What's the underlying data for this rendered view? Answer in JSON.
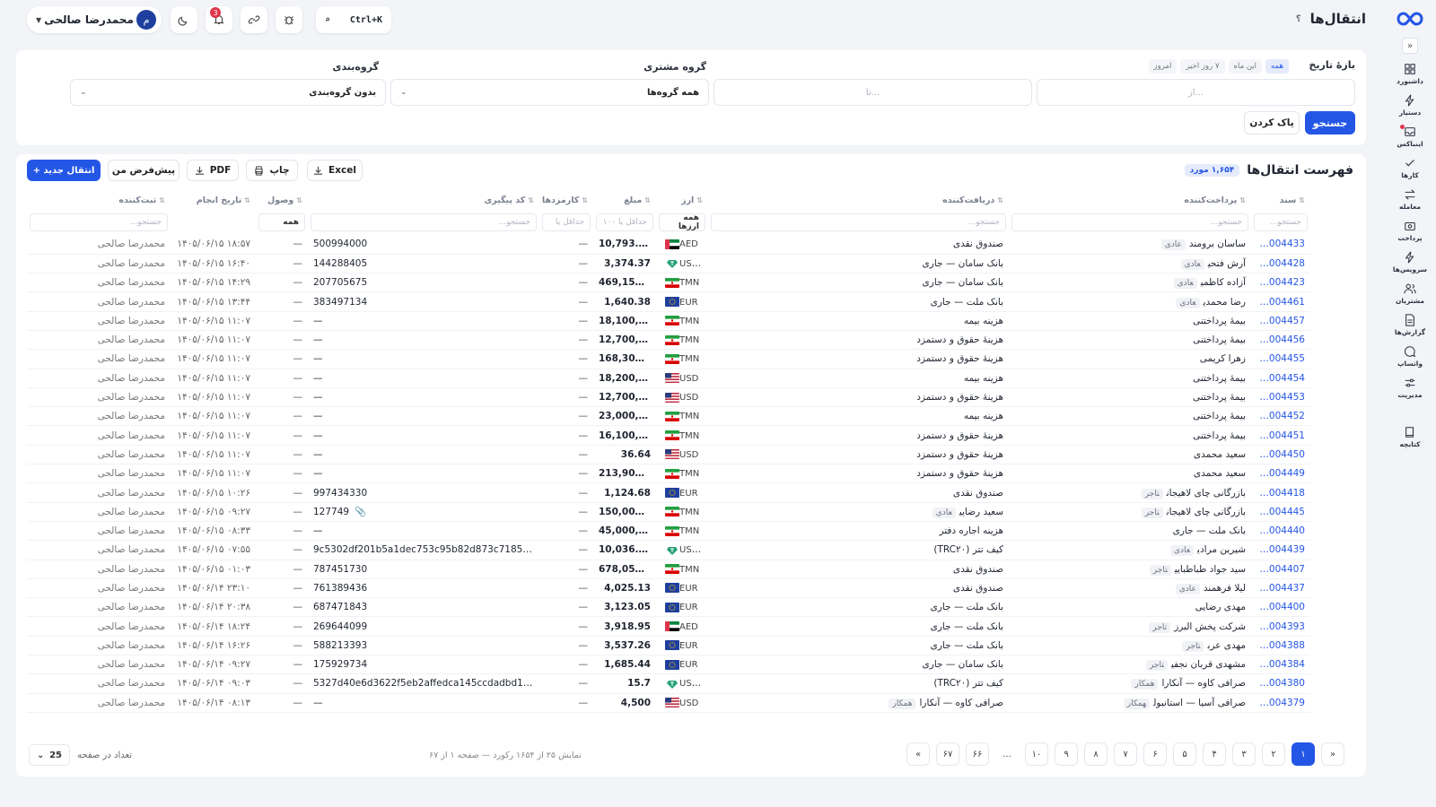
{
  "header": {
    "title": "انتقال‌ها",
    "help": "؟",
    "search_shortcut": "Ctrl+K",
    "notifications_count": "3",
    "user_name": "محمدرضا صالحی",
    "user_initial": "م"
  },
  "sidebar": {
    "items": [
      {
        "label": "داشبورد",
        "icon": "dashboard-icon"
      },
      {
        "label": "دستیار",
        "icon": "bolt-icon"
      },
      {
        "label": "اینباکس",
        "icon": "inbox-icon"
      },
      {
        "label": "کارها",
        "icon": "check-icon"
      },
      {
        "label": "معامله",
        "icon": "swap-icon"
      },
      {
        "label": "پرداخت",
        "icon": "payment-icon"
      },
      {
        "label": "سرویس‌ها",
        "icon": "bolt-icon"
      },
      {
        "label": "مشتریان",
        "icon": "users-icon"
      },
      {
        "label": "گزارش‌ها",
        "icon": "report-icon"
      },
      {
        "label": "واتساپ",
        "icon": "chat-icon"
      },
      {
        "label": "مدیریت",
        "icon": "sliders-icon"
      },
      {
        "label": "کتابچه",
        "icon": "book-icon"
      }
    ]
  },
  "filters": {
    "date_range_label": "بازهٔ تاریخ",
    "quick_ranges": [
      "همه",
      "این ماه",
      "۷ روز اخیر",
      "امروز"
    ],
    "from_placeholder": "از...",
    "to_placeholder": "تا...",
    "customer_group_label": "گروه مشتری",
    "customer_group_value": "همه گروه‌ها",
    "grouping_label": "گروه‌بندی",
    "grouping_value": "بدون گروه‌بندی",
    "search_button": "جستجو",
    "clear_button": "پاک کردن"
  },
  "list": {
    "title": "فهرست انتقال‌ها",
    "count": "۱,۶۵۴ مورد",
    "new_button": "+ انتقال جدید",
    "default_button": "پیش‌فرض من",
    "pdf_button": "PDF",
    "print_button": "چاپ",
    "excel_button": "Excel",
    "columns": [
      "سند",
      "پرداخت‌کننده",
      "دریافت‌کننده",
      "ارز",
      "مبلغ",
      "کارمزدها",
      "کد پیگیری",
      "وصول",
      "تاریخ انجام",
      "ثبت‌کننده"
    ],
    "column_filters": {
      "doc": "جستجو...",
      "payer": "جستجو...",
      "receiver": "جستجو...",
      "currency": "همه ارزها",
      "amount": "حداقل یا ۱۰۰",
      "fees": "حداقل یا",
      "ref": "جستجو...",
      "received": "همه",
      "registrar": "جستجو..."
    },
    "rows": [
      {
        "doc": "NX-004433",
        "payer": "ساسان برومند",
        "payer_tag": "عادی",
        "receiver": "صندوق نقدی",
        "receiver_tag": "",
        "cur": "AED",
        "amt": "10,793.44",
        "fees": "—",
        "ref": "500994000",
        "rcv": "—",
        "date": "۱۴۰۵/۰۶/۱۵ ۱۸:۵۷",
        "reg": "محمدرضا صالحی"
      },
      {
        "doc": "NX-004428",
        "payer": "آرش فتحی",
        "payer_tag": "عادی",
        "receiver": "بانک سامان — جاری",
        "receiver_tag": "",
        "cur": "USDT",
        "amt": "3,374.37",
        "fees": "—",
        "ref": "144288405",
        "rcv": "—",
        "date": "۱۴۰۵/۰۶/۱۵ ۱۶:۴۰",
        "reg": "محمدرضا صالحی"
      },
      {
        "doc": "NX-004423",
        "payer": "آزاده کاظمی",
        "payer_tag": "عادی",
        "receiver": "بانک سامان — جاری",
        "receiver_tag": "",
        "cur": "TMN",
        "amt": "469,153,100",
        "fees": "—",
        "ref": "207705675",
        "rcv": "—",
        "date": "۱۴۰۵/۰۶/۱۵ ۱۴:۲۹",
        "reg": "محمدرضا صالحی"
      },
      {
        "doc": "NX-004461",
        "payer": "رضا محمدی",
        "payer_tag": "عادی",
        "receiver": "بانک ملت — جاری",
        "receiver_tag": "",
        "cur": "EUR",
        "amt": "1,640.38",
        "fees": "—",
        "ref": "383497134",
        "rcv": "—",
        "date": "۱۴۰۵/۰۶/۱۵ ۱۳:۴۴",
        "reg": "محمدرضا صالحی"
      },
      {
        "doc": "NX-004457",
        "payer": "بیمهٔ پرداختنی",
        "payer_tag": "",
        "receiver": "هزینه بیمه",
        "receiver_tag": "",
        "cur": "TMN",
        "amt": "18,100,000",
        "fees": "—",
        "ref": "—",
        "rcv": "—",
        "date": "۱۴۰۵/۰۶/۱۵ ۱۱:۰۷",
        "reg": "محمدرضا صالحی"
      },
      {
        "doc": "NX-004456",
        "payer": "بیمهٔ پرداختنی",
        "payer_tag": "",
        "receiver": "هزینهٔ حقوق و دستمزد",
        "receiver_tag": "",
        "cur": "TMN",
        "amt": "12,700,000",
        "fees": "—",
        "ref": "—",
        "rcv": "—",
        "date": "۱۴۰۵/۰۶/۱۵ ۱۱:۰۷",
        "reg": "محمدرضا صالحی"
      },
      {
        "doc": "NX-004455",
        "payer": "زهرا کریمی",
        "payer_tag": "",
        "receiver": "هزینهٔ حقوق و دستمزد",
        "receiver_tag": "",
        "cur": "TMN",
        "amt": "168,300,000",
        "fees": "—",
        "ref": "—",
        "rcv": "—",
        "date": "۱۴۰۵/۰۶/۱۵ ۱۱:۰۷",
        "reg": "محمدرضا صالحی"
      },
      {
        "doc": "NX-004454",
        "payer": "بیمهٔ پرداختنی",
        "payer_tag": "",
        "receiver": "هزینه بیمه",
        "receiver_tag": "",
        "cur": "USD",
        "amt": "18,200,000",
        "fees": "—",
        "ref": "—",
        "rcv": "—",
        "date": "۱۴۰۵/۰۶/۱۵ ۱۱:۰۷",
        "reg": "محمدرضا صالحی"
      },
      {
        "doc": "NX-004453",
        "payer": "بیمهٔ پرداختنی",
        "payer_tag": "",
        "receiver": "هزینهٔ حقوق و دستمزد",
        "receiver_tag": "",
        "cur": "USD",
        "amt": "12,700,000",
        "fees": "—",
        "ref": "—",
        "rcv": "—",
        "date": "۱۴۰۵/۰۶/۱۵ ۱۱:۰۷",
        "reg": "محمدرضا صالحی"
      },
      {
        "doc": "NX-004452",
        "payer": "بیمهٔ پرداختنی",
        "payer_tag": "",
        "receiver": "هزینه بیمه",
        "receiver_tag": "",
        "cur": "TMN",
        "amt": "23,000,000",
        "fees": "—",
        "ref": "—",
        "rcv": "—",
        "date": "۱۴۰۵/۰۶/۱۵ ۱۱:۰۷",
        "reg": "محمدرضا صالحی"
      },
      {
        "doc": "NX-004451",
        "payer": "بیمهٔ پرداختنی",
        "payer_tag": "",
        "receiver": "هزینهٔ حقوق و دستمزد",
        "receiver_tag": "",
        "cur": "TMN",
        "amt": "16,100,000",
        "fees": "—",
        "ref": "—",
        "rcv": "—",
        "date": "۱۴۰۵/۰۶/۱۵ ۱۱:۰۷",
        "reg": "محمدرضا صالحی"
      },
      {
        "doc": "NX-004450",
        "payer": "سعید محمدی",
        "payer_tag": "",
        "receiver": "هزینهٔ حقوق و دستمزد",
        "receiver_tag": "",
        "cur": "USD",
        "amt": "36.64",
        "fees": "—",
        "ref": "—",
        "rcv": "—",
        "date": "۱۴۰۵/۰۶/۱۵ ۱۱:۰۷",
        "reg": "محمدرضا صالحی"
      },
      {
        "doc": "NX-004449",
        "payer": "سعید محمدی",
        "payer_tag": "",
        "receiver": "هزینهٔ حقوق و دستمزد",
        "receiver_tag": "",
        "cur": "TMN",
        "amt": "213,900,200",
        "fees": "—",
        "ref": "—",
        "rcv": "—",
        "date": "۱۴۰۵/۰۶/۱۵ ۱۱:۰۷",
        "reg": "محمدرضا صالحی"
      },
      {
        "doc": "NX-004418",
        "payer": "بازرگانی چای لاهیجان",
        "payer_tag": "تاجر",
        "receiver": "صندوق نقدی",
        "receiver_tag": "",
        "cur": "EUR",
        "amt": "1,124.68",
        "fees": "—",
        "ref": "997434330",
        "rcv": "—",
        "date": "۱۴۰۵/۰۶/۱۵ ۱۰:۲۶",
        "reg": "محمدرضا صالحی"
      },
      {
        "doc": "NX-004445",
        "payer": "بازرگانی چای لاهیجان",
        "payer_tag": "تاجر",
        "receiver": "سعید رضایی",
        "receiver_tag": "عادی",
        "cur": "TMN",
        "amt": "150,000,000",
        "fees": "—",
        "ref": "127749",
        "rcv": "—",
        "date": "۱۴۰۵/۰۶/۱۵ ۰۹:۲۷",
        "reg": "محمدرضا صالحی",
        "attach": true
      },
      {
        "doc": "NX-004440",
        "payer": "بانک ملت — جاری",
        "payer_tag": "",
        "receiver": "هزینه اجاره دفتر",
        "receiver_tag": "",
        "cur": "TMN",
        "amt": "45,000,000",
        "fees": "—",
        "ref": "—",
        "rcv": "—",
        "date": "۱۴۰۵/۰۶/۱۵ ۰۸:۳۳",
        "reg": "محمدرضا صالحی"
      },
      {
        "doc": "NX-004439",
        "payer": "شیرین مرادی",
        "payer_tag": "عادی",
        "receiver": "کیف تتر (TRC۲۰)",
        "receiver_tag": "",
        "cur": "USDT",
        "amt": "10,036.78",
        "fees": "—",
        "ref": "9c5302df201b5a1dec753c95b82d873c718553c...",
        "rcv": "—",
        "date": "۱۴۰۵/۰۶/۱۵ ۰۷:۵۵",
        "reg": "محمدرضا صالحی"
      },
      {
        "doc": "NX-004407",
        "payer": "سید جواد طباطبایی",
        "payer_tag": "تاجر",
        "receiver": "صندوق نقدی",
        "receiver_tag": "",
        "cur": "TMN",
        "amt": "678,054,700",
        "fees": "—",
        "ref": "787451730",
        "rcv": "—",
        "date": "۱۴۰۵/۰۶/۱۵ ۰۱:۰۳",
        "reg": "محمدرضا صالحی"
      },
      {
        "doc": "NX-004437",
        "payer": "لیلا فرهمند",
        "payer_tag": "عادی",
        "receiver": "صندوق نقدی",
        "receiver_tag": "",
        "cur": "EUR",
        "amt": "4,025.13",
        "fees": "—",
        "ref": "761389436",
        "rcv": "—",
        "date": "۱۴۰۵/۰۶/۱۴ ۲۳:۱۰",
        "reg": "محمدرضا صالحی"
      },
      {
        "doc": "NX-004400",
        "payer": "مهدی رضایی",
        "payer_tag": "",
        "receiver": "بانک ملت — جاری",
        "receiver_tag": "",
        "cur": "EUR",
        "amt": "3,123.05",
        "fees": "—",
        "ref": "687471843",
        "rcv": "—",
        "date": "۱۴۰۵/۰۶/۱۴ ۲۰:۳۸",
        "reg": "محمدرضا صالحی"
      },
      {
        "doc": "NX-004393",
        "payer": "شرکت پخش البرز",
        "payer_tag": "تاجر",
        "receiver": "بانک ملت — جاری",
        "receiver_tag": "",
        "cur": "AED",
        "amt": "3,918.95",
        "fees": "—",
        "ref": "269644099",
        "rcv": "—",
        "date": "۱۴۰۵/۰۶/۱۴ ۱۸:۲۴",
        "reg": "محمدرضا صالحی"
      },
      {
        "doc": "NX-004388",
        "payer": "مهدی عرب",
        "payer_tag": "تاجر",
        "receiver": "بانک ملت — جاری",
        "receiver_tag": "",
        "cur": "EUR",
        "amt": "3,537.26",
        "fees": "—",
        "ref": "588213393",
        "rcv": "—",
        "date": "۱۴۰۵/۰۶/۱۴ ۱۶:۲۶",
        "reg": "محمدرضا صالحی"
      },
      {
        "doc": "NX-004384",
        "payer": "مشهدی قربان نجفی",
        "payer_tag": "تاجر",
        "receiver": "بانک سامان — جاری",
        "receiver_tag": "",
        "cur": "EUR",
        "amt": "1,685.44",
        "fees": "—",
        "ref": "175929734",
        "rcv": "—",
        "date": "۱۴۰۵/۰۶/۱۴ ۰۹:۲۷",
        "reg": "محمدرضا صالحی"
      },
      {
        "doc": "NX-004380",
        "payer": "صرافی کاوه — آنکارا",
        "payer_tag": "همکار",
        "receiver": "کیف تتر (TRC۲۰)",
        "receiver_tag": "",
        "cur": "USDT",
        "amt": "15.7",
        "fees": "—",
        "ref": "5327d40e6d3622f5eb2affedca145ccdadbd1928...",
        "rcv": "—",
        "date": "۱۴۰۵/۰۶/۱۴ ۰۹:۰۳",
        "reg": "محمدرضا صالحی"
      },
      {
        "doc": "NX-004379",
        "payer": "صرافی آسیا — استانبول",
        "payer_tag": "همکار",
        "receiver": "صرافی کاوه — آنکارا",
        "receiver_tag": "همکار",
        "cur": "USD",
        "amt": "4,500",
        "fees": "—",
        "ref": "—",
        "rcv": "—",
        "date": "۱۴۰۵/۰۶/۱۴ ۰۸:۱۳",
        "reg": "محمدرضا صالحی"
      }
    ]
  },
  "pagination": {
    "pages": [
      "۱",
      "۲",
      "۳",
      "۴",
      "۵",
      "۶",
      "۷",
      "۸",
      "۹",
      "۱۰",
      "...",
      "۶۶",
      "۶۷"
    ],
    "current": "۱",
    "showing": "نمایش ۲۵ از ۱۶۵۴ رکورد — صفحه ۱ از ۶۷",
    "per_page_label": "تعداد در صفحه",
    "per_page_value": "25"
  },
  "colors": {
    "accent": "#2456e6",
    "danger": "#e0344a"
  }
}
